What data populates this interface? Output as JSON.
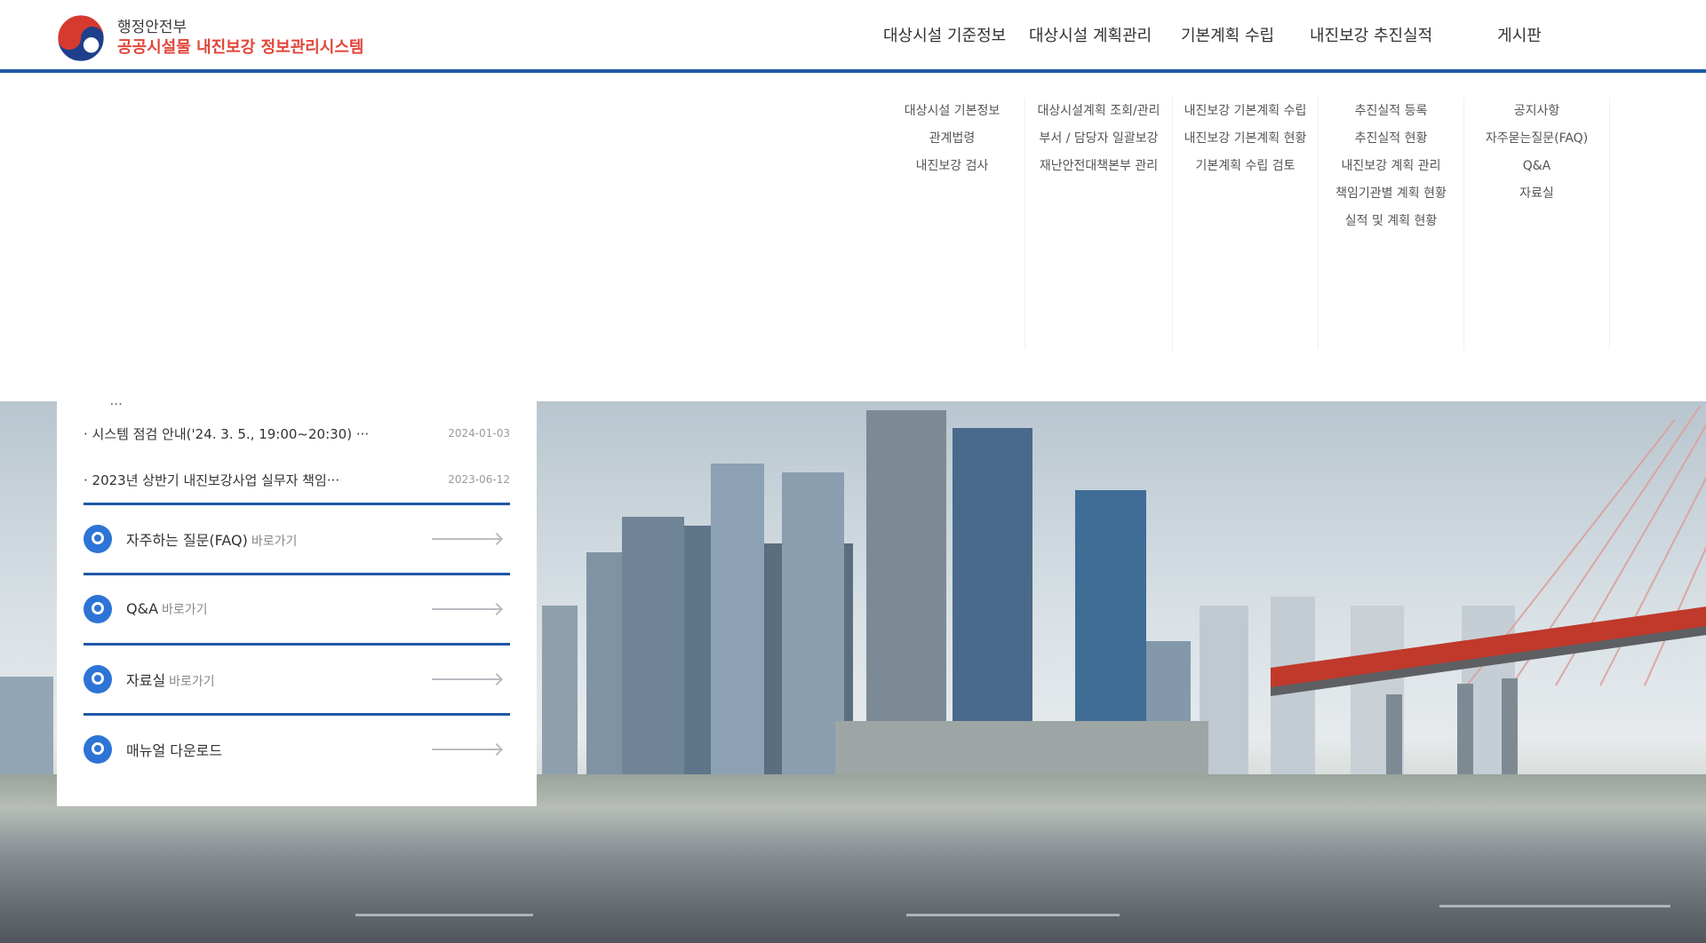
{
  "header": {
    "ministry": "행정안전부",
    "system_name": "공공시설물 내진보강 정보관리시스템"
  },
  "nav": {
    "items": [
      {
        "label": "대상시설 기준정보",
        "subs": [
          "대상시설 기본정보",
          "관계법령",
          "내진보강 검사"
        ]
      },
      {
        "label": "대상시설 계획관리",
        "subs": [
          "대상시설계획 조회/관리",
          "부서 / 담당자 일괄보강",
          "재난안전대책본부 관리"
        ]
      },
      {
        "label": "기본계획 수립",
        "subs": [
          "내진보강 기본계획 수립",
          "내진보강 기본계획 현황",
          "기본계획 수립 검토"
        ]
      },
      {
        "label": "내진보강 추진실적",
        "subs": [
          "추진실적 등록",
          "추진실적 현황",
          "내진보강 계획 관리",
          "책임기관별 계획 현황",
          "실적 및 계획 현황"
        ]
      },
      {
        "label": "게시판",
        "subs": [
          "공지사항",
          "자주묻는질문(FAQ)",
          "Q&A",
          "자료실"
        ]
      }
    ]
  },
  "board": {
    "clipped_notice": "· ...",
    "notices": [
      {
        "title": "· 시스템 점검 안내('24. 3. 5., 19:00~20:30) ···",
        "date": "2024-01-03"
      },
      {
        "title": "· 2023년 상반기 내진보강사업 실무자 책임···",
        "date": "2023-06-12"
      }
    ],
    "quick_links": [
      {
        "label": "자주하는 질문(FAQ)",
        "suffix": "바로가기"
      },
      {
        "label": "Q&A",
        "suffix": "바로가기"
      },
      {
        "label": "자료실",
        "suffix": "바로가기"
      },
      {
        "label": "매뉴얼 다운로드",
        "suffix": ""
      }
    ]
  },
  "colors": {
    "brand_blue": "#1f57a6",
    "title_red": "#e2463a",
    "icon_blue": "#2d74d6"
  }
}
